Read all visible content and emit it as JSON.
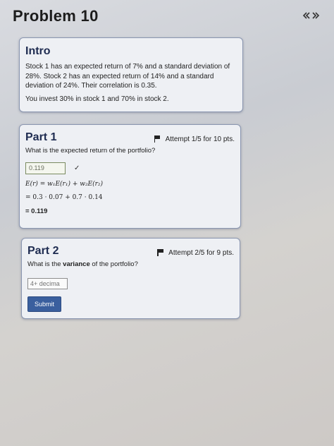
{
  "header": {
    "title": "Problem 10",
    "nav_icons": [
      "chevron-left-icon",
      "chevron-right-icon"
    ]
  },
  "intro": {
    "heading": "Intro",
    "paragraph1": "Stock 1 has an expected return of 7% and a standard deviation of 28%. Stock 2 has an expected return of 14% and a standard deviation of 24%. Their correlation is 0.35.",
    "paragraph2": "You invest 30% in stock 1 and 70% in stock 2."
  },
  "part1": {
    "heading": "Part 1",
    "attempt": "Attempt 1/5 for 10 pts.",
    "question": "What is the expected return of the portfolio?",
    "answer_value": "0.119",
    "check": "✓",
    "formula": "E(r) = w₁E(r₁) + w₂E(r₂)",
    "step": "= 0.3 · 0.07 + 0.7 · 0.14",
    "result": "= 0.119"
  },
  "part2": {
    "heading": "Part 2",
    "attempt": "Attempt 2/5 for 9 pts.",
    "question_pre": "What is the ",
    "question_bold": "variance",
    "question_post": " of the portfolio?",
    "input_placeholder": "4+ decima",
    "submit_label": "Submit"
  },
  "colors": {
    "accent": "#3a5f9e",
    "heading": "#1e2b50",
    "card_border": "#8a96b0"
  }
}
